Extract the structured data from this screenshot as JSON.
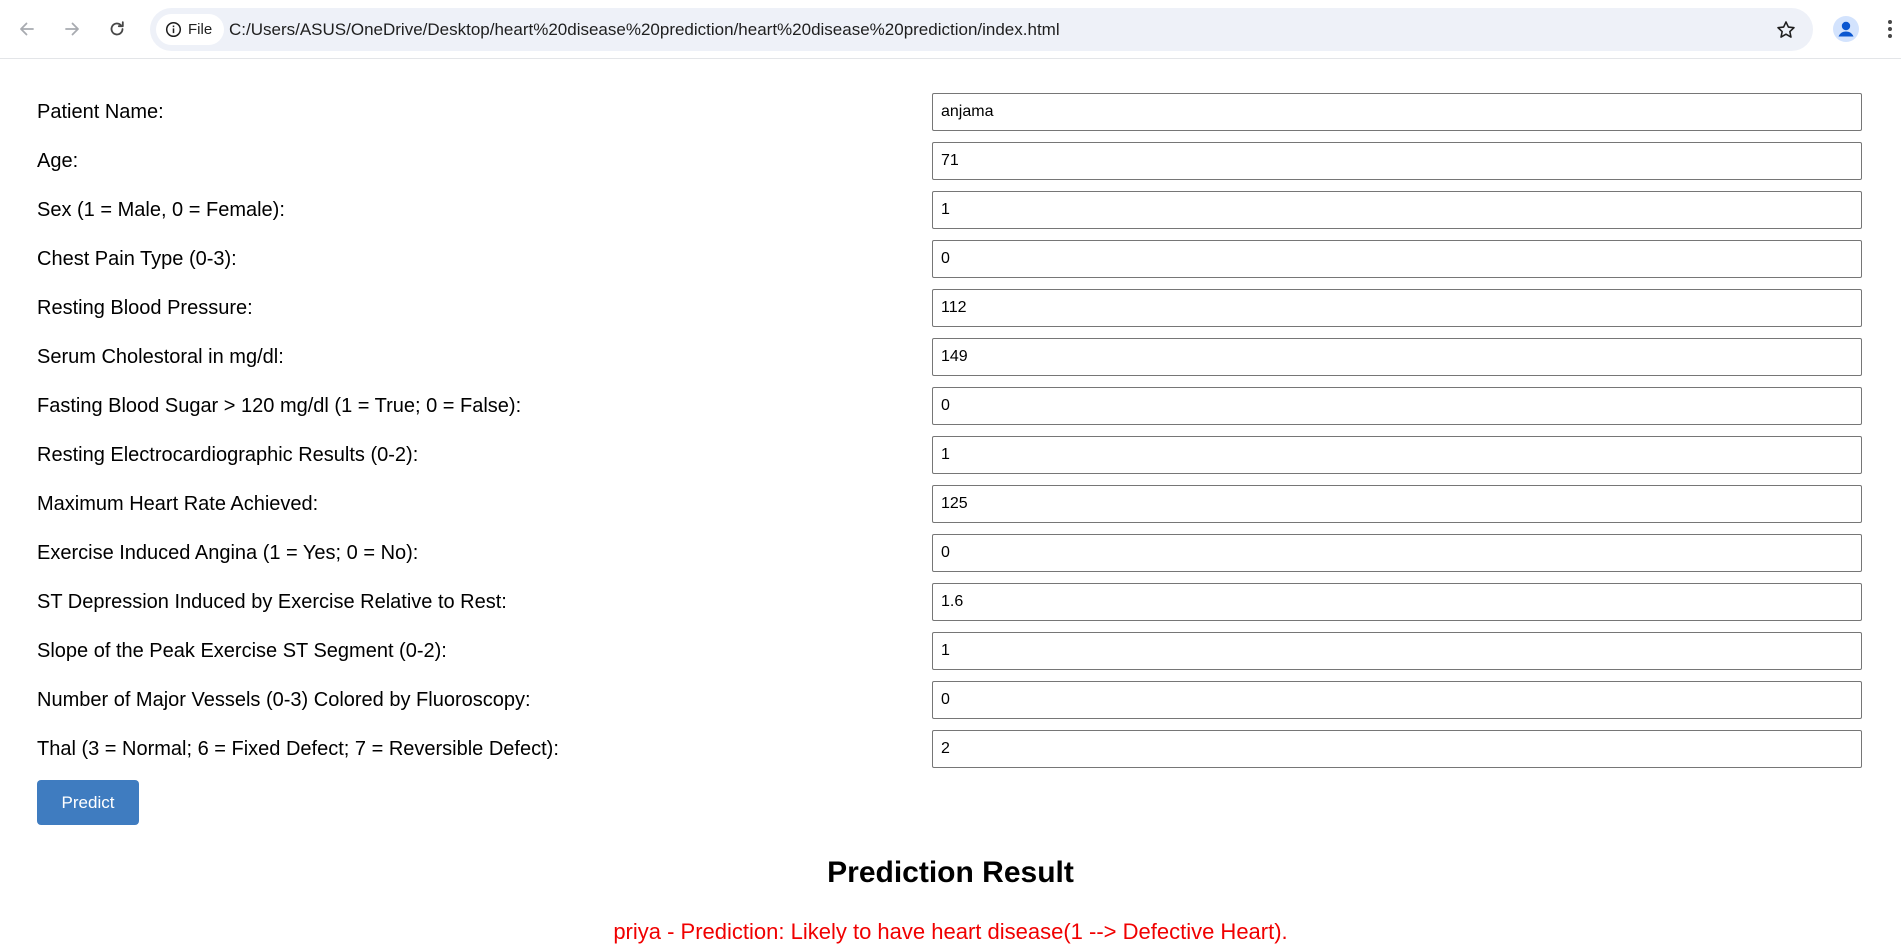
{
  "browser": {
    "url": "C:/Users/ASUS/OneDrive/Desktop/heart%20disease%20prediction/heart%20disease%20prediction/index.html",
    "site_chip_label": "File",
    "icons": {
      "back": "back-arrow-icon",
      "forward": "forward-arrow-icon",
      "reload": "reload-icon",
      "info": "info-icon",
      "bookmark": "star-icon",
      "profile": "profile-icon",
      "menu": "kebab-menu-icon"
    }
  },
  "form": {
    "fields": [
      {
        "label": "Patient Name:",
        "value": "anjama"
      },
      {
        "label": "Age:",
        "value": "71"
      },
      {
        "label": "Sex (1 = Male, 0 = Female):",
        "value": "1"
      },
      {
        "label": "Chest Pain Type (0-3):",
        "value": "0"
      },
      {
        "label": "Resting Blood Pressure:",
        "value": "112"
      },
      {
        "label": "Serum Cholestoral in mg/dl:",
        "value": "149"
      },
      {
        "label": "Fasting Blood Sugar > 120 mg/dl (1 = True; 0 = False):",
        "value": "0"
      },
      {
        "label": "Resting Electrocardiographic Results (0-2):",
        "value": "1"
      },
      {
        "label": "Maximum Heart Rate Achieved:",
        "value": "125"
      },
      {
        "label": "Exercise Induced Angina (1 = Yes; 0 = No):",
        "value": "0"
      },
      {
        "label": "ST Depression Induced by Exercise Relative to Rest:",
        "value": "1.6"
      },
      {
        "label": "Slope of the Peak Exercise ST Segment (0-2):",
        "value": "1"
      },
      {
        "label": "Number of Major Vessels (0-3) Colored by Fluoroscopy:",
        "value": "0"
      },
      {
        "label": "Thal (3 = Normal; 6 = Fixed Defect; 7 = Reversible Defect):",
        "value": "2"
      }
    ],
    "submit_label": "Predict"
  },
  "result": {
    "title": "Prediction Result",
    "text": "priya - Prediction: Likely to have heart disease(1 --> Defective Heart)."
  },
  "colors": {
    "button": "#3f7cc0",
    "result_text": "#f00000",
    "omnibox": "#eef1f8"
  }
}
